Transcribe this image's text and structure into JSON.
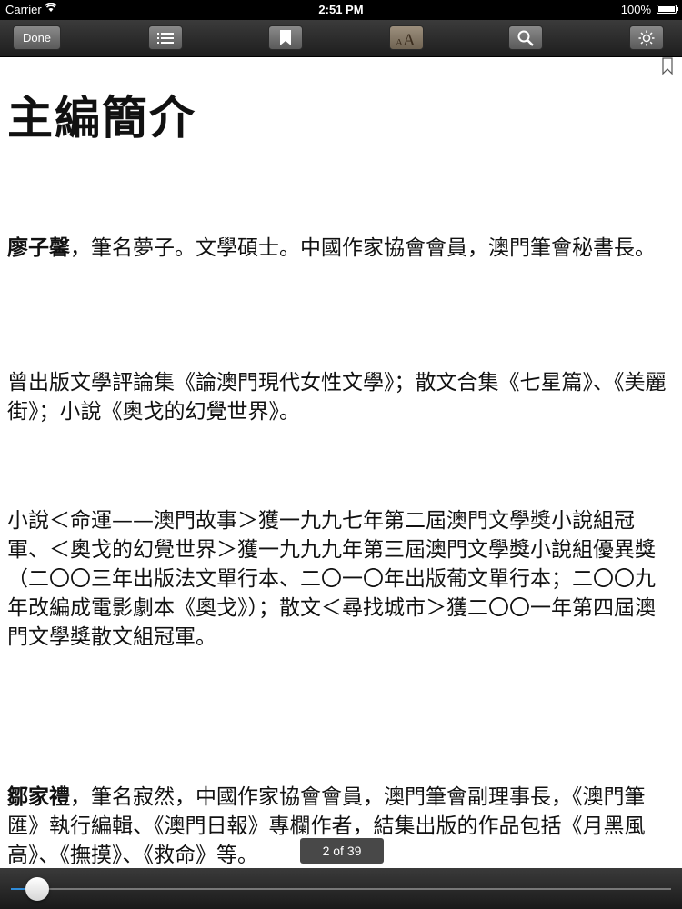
{
  "status_bar": {
    "carrier": "Carrier",
    "time": "2:51 PM",
    "battery": "100%",
    "battery_level": 1.0
  },
  "toolbar": {
    "done_label": "Done",
    "icons": [
      "list-icon",
      "bookmark-icon",
      "font-size-icon",
      "search-icon",
      "brightness-icon"
    ]
  },
  "book": {
    "chapter_title": "主編簡介",
    "paragraphs": [
      {
        "bold": "廖子馨",
        "text": "，筆名夢子。文學碩士。中國作家協會會員，澳門筆會秘書長。"
      },
      {
        "bold": "",
        "text": "曾出版文學評論集《論澳門現代女性文學》；散文合集《七星篇》、《美麗街》；小說《奧戈的幻覺世界》。"
      },
      {
        "bold": "",
        "text": "小說＜命運——澳門故事＞獲一九九七年第二屆澳門文學獎小說組冠軍、＜奧戈的幻覺世界＞獲一九九九年第三屆澳門文學獎小說組優異獎（二〇〇三年出版法文單行本、二〇一〇年出版葡文單行本；二〇〇九年改編成電影劇本《奧戈》）；散文＜尋找城市＞獲二〇〇一年第四屆澳門文學獎散文組冠軍。"
      },
      {
        "bold": "鄒家禮",
        "text": "，筆名寂然，中國作家協會會員，澳門筆會副理事長，《澳門筆匯》執行編輯、《澳門日報》專欄作者，結集出版的作品包括《月黑風高》、《撫摸》、《救命》等。"
      }
    ]
  },
  "page_indicator": "2 of 39",
  "scrubber": {
    "current_page": 2,
    "total_pages": 39
  }
}
